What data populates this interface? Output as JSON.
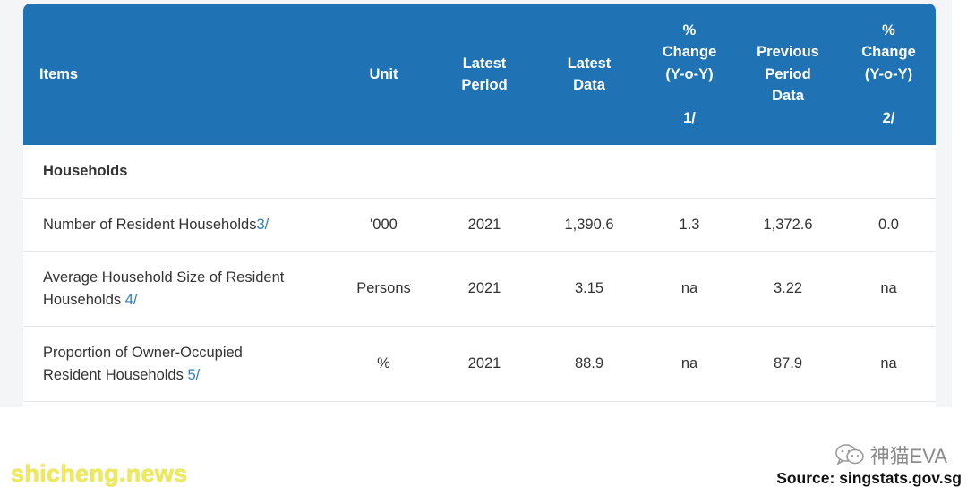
{
  "table": {
    "headers": {
      "items": "Items",
      "unit": "Unit",
      "latest_period": "Latest\nPeriod",
      "latest_data": "Latest\nData",
      "change1": "%\nChange\n(Y-o-Y)",
      "change1_note": "1/",
      "previous_period_data": "Previous\nPeriod\nData",
      "change2": "%\nChange\n(Y-o-Y)",
      "change2_note": "2/"
    },
    "section": "Households",
    "rows": [
      {
        "item_line1": "Number of Resident Households",
        "item_line2": "",
        "note": "3/",
        "unit": "'000",
        "latest_period": "2021",
        "latest_data": "1,390.6",
        "change1": "1.3",
        "previous_data": "1,372.6",
        "change2": "0.0"
      },
      {
        "item_line1": "Average Household Size of Resident",
        "item_line2": "Households ",
        "note": "4/",
        "unit": "Persons",
        "latest_period": "2021",
        "latest_data": "3.15",
        "change1": "na",
        "previous_data": "3.22",
        "change2": "na"
      },
      {
        "item_line1": "Proportion of Owner-Occupied",
        "item_line2": "Resident Households ",
        "note": "5/",
        "unit": "%",
        "latest_period": "2021",
        "latest_data": "88.9",
        "change1": "na",
        "previous_data": "87.9",
        "change2": "na"
      }
    ]
  },
  "watermark": {
    "text": "神猫EVA",
    "icon": "wechat-icon"
  },
  "source_text": "Source: singstats.gov.sg",
  "brand_text": "shicheng.news",
  "colors": {
    "header": "#1f73b4",
    "link": "#2f7dc5",
    "brand": "#eeea5a"
  }
}
